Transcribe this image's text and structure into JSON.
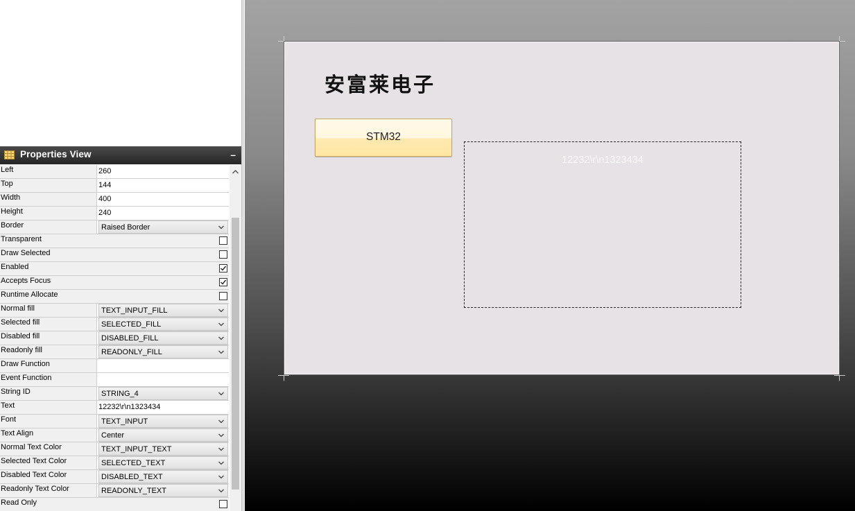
{
  "properties_view": {
    "title": "Properties View",
    "minimize_label": "–",
    "rows": [
      {
        "label": "Left",
        "type": "text",
        "value": "260"
      },
      {
        "label": "Top",
        "type": "text",
        "value": "144"
      },
      {
        "label": "Width",
        "type": "text",
        "value": "400"
      },
      {
        "label": "Height",
        "type": "text",
        "value": "240"
      },
      {
        "label": "Border",
        "type": "combo",
        "value": "Raised Border"
      },
      {
        "label": "Transparent",
        "type": "check",
        "checked": false
      },
      {
        "label": "Draw Selected",
        "type": "check",
        "checked": false
      },
      {
        "label": "Enabled",
        "type": "check",
        "checked": true
      },
      {
        "label": "Accepts Focus",
        "type": "check",
        "checked": true
      },
      {
        "label": "Runtime Allocate",
        "type": "check",
        "checked": false
      },
      {
        "label": "Normal fill",
        "type": "combo",
        "value": "TEXT_INPUT_FILL"
      },
      {
        "label": "Selected fill",
        "type": "combo",
        "value": "SELECTED_FILL"
      },
      {
        "label": "Disabled fill",
        "type": "combo",
        "value": "DISABLED_FILL"
      },
      {
        "label": "Readonly fill",
        "type": "combo",
        "value": "READONLY_FILL"
      },
      {
        "label": "Draw Function",
        "type": "text",
        "value": ""
      },
      {
        "label": "Event Function",
        "type": "text",
        "value": ""
      },
      {
        "label": "String ID",
        "type": "combo",
        "value": "STRING_4"
      },
      {
        "label": "Text",
        "type": "text",
        "value": "12232\\r\\n1323434"
      },
      {
        "label": "Font",
        "type": "combo",
        "value": "TEXT_INPUT"
      },
      {
        "label": "Text Align",
        "type": "combo",
        "value": "Center"
      },
      {
        "label": "Normal Text Color",
        "type": "combo",
        "value": "TEXT_INPUT_TEXT"
      },
      {
        "label": "Selected Text Color",
        "type": "combo",
        "value": "SELECTED_TEXT"
      },
      {
        "label": "Disabled Text Color",
        "type": "combo",
        "value": "DISABLED_TEXT"
      },
      {
        "label": "Readonly Text Color",
        "type": "combo",
        "value": "READONLY_TEXT"
      },
      {
        "label": "Read Only",
        "type": "check",
        "checked": false
      }
    ]
  },
  "canvas": {
    "logo_text": "安富莱电子",
    "button_label": "STM32",
    "text_widget_content": "12232\\r\\n1323434"
  },
  "colors": {
    "panel_header": "#2b2b2b",
    "canvas_bg": "#e7e2e6",
    "button_fill": "#ffe9b0",
    "widget_text": "#f8f8f8"
  },
  "icons": [
    "grid-icon",
    "chevron-down-icon",
    "checkmark-icon",
    "scroll-up-icon"
  ]
}
